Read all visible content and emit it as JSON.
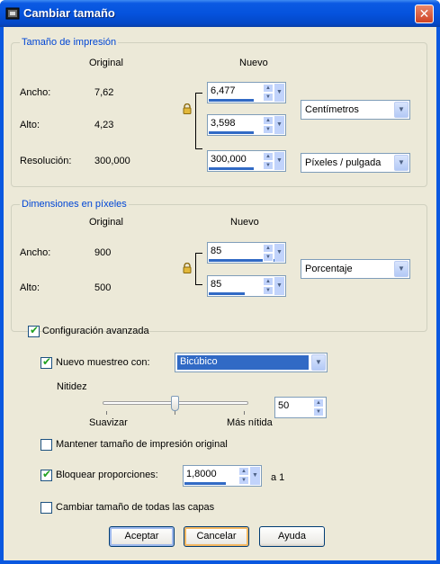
{
  "window": {
    "title": "Cambiar tamaño",
    "close_glyph": "✕"
  },
  "print_group": {
    "title": "Tamaño de impresión",
    "col_original": "Original",
    "col_nuevo": "Nuevo",
    "width": {
      "label": "Ancho:",
      "original": "7,62",
      "nuevo": "6,477"
    },
    "height": {
      "label": "Alto:",
      "original": "4,23",
      "nuevo": "3,598"
    },
    "resolution": {
      "label": "Resolución:",
      "original": "300,000",
      "nuevo": "300,000"
    },
    "units": "Centímetros",
    "res_units": "Píxeles / pulgada"
  },
  "pixel_group": {
    "title": "Dimensiones en píxeles",
    "col_original": "Original",
    "col_nuevo": "Nuevo",
    "width": {
      "label": "Ancho:",
      "original": "900",
      "nuevo": "85"
    },
    "height": {
      "label": "Alto:",
      "original": "500",
      "nuevo": "85"
    },
    "units": "Porcentaje"
  },
  "advanced": {
    "label": "Configuración avanzada",
    "checked": true,
    "resample_label": "Nuevo muestreo con:",
    "resample_checked": true,
    "resample_value": "Bicúbico",
    "sharpness_label": "Nitidez",
    "smooth_label": "Suavizar",
    "sharp_label": "Más nítida",
    "sharpness_value": "50",
    "sharpness_level": 0.5,
    "keep_print_label": "Mantener tamaño de impresión original",
    "keep_print_checked": false,
    "lock_ratio_label": "Bloquear proporciones:",
    "lock_ratio_checked": true,
    "ratio_value": "1,8000",
    "ratio_suffix": "a 1",
    "all_layers_label": "Cambiar tamaño de todas las capas",
    "all_layers_checked": false
  },
  "buttons": {
    "ok": "Aceptar",
    "cancel": "Cancelar",
    "help": "Ayuda"
  },
  "icons": {
    "app": "app-icon",
    "lock": "lock-icon",
    "check": "✔"
  },
  "colors": {
    "title_bar": "#0553dd",
    "legend_text": "#0046d5",
    "selection": "#316ac5",
    "check": "#21a121"
  }
}
